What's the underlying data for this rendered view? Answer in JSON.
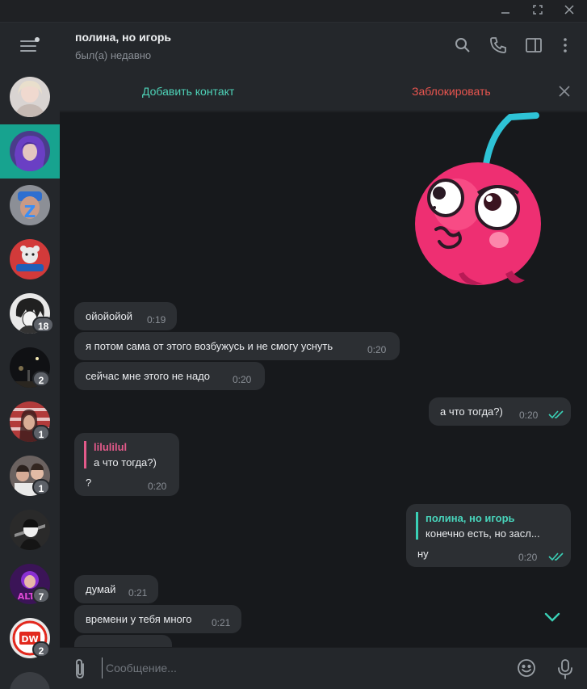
{
  "window": {
    "controls": [
      "minimize",
      "maximize",
      "close"
    ]
  },
  "header": {
    "peer_name": "полина, но игорь",
    "peer_status": "был(а) недавно"
  },
  "actionbar": {
    "add_contact": "Добавить контакт",
    "block": "Заблокировать"
  },
  "chats": [
    {
      "badge": ""
    },
    {
      "badge": ""
    },
    {
      "badge": ""
    },
    {
      "badge": ""
    },
    {
      "badge": "18"
    },
    {
      "badge": "2"
    },
    {
      "badge": "1"
    },
    {
      "badge": "1"
    },
    {
      "badge": ""
    },
    {
      "badge": "7"
    },
    {
      "badge": "2"
    }
  ],
  "messages": [
    {
      "text": "ойойойой",
      "time": "0:19"
    },
    {
      "text": "я потом сама от этого возбужусь и не смогу уснуть",
      "time": "0:20"
    },
    {
      "text": "сейчас мне этого не надо",
      "time": "0:20"
    },
    {
      "text": "а что тогда?)",
      "time": "0:20"
    },
    {
      "reply_author": "lilulilul",
      "reply_text": "а что тогда?)",
      "text": "?",
      "time": "0:20"
    },
    {
      "reply_author": "полина, но игорь",
      "reply_text": "конечно есть, но засл...",
      "text": "ну",
      "time": "0:20"
    },
    {
      "text": "думай",
      "time": "0:21"
    },
    {
      "text": "времени у тебя много",
      "time": "0:21"
    }
  ],
  "composer": {
    "placeholder": "Сообщение..."
  },
  "colors": {
    "accent": "#17a38f",
    "link": "#4ed3b8",
    "danger": "#e8554f",
    "reply_pink": "#e35a8a"
  }
}
